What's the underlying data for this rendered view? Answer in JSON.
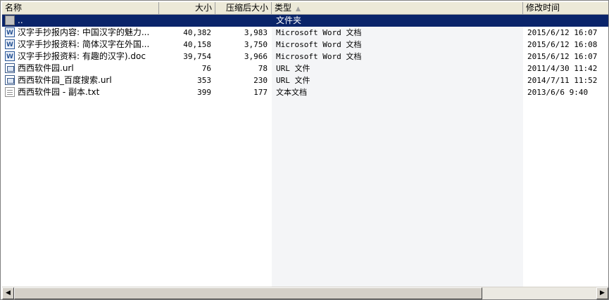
{
  "columns": {
    "name": "名称",
    "size": "大小",
    "compressed": "压缩后大小",
    "type": "类型",
    "modified": "修改时间"
  },
  "icons": {
    "sort_indicator": "sort-ascending-icon",
    "scroll_left": "◀",
    "scroll_right": "▶"
  },
  "colors": {
    "selection": "#0a246a",
    "sorted_column_bg": "#f4f5f7"
  },
  "rows": [
    {
      "icon": "parent-folder-icon",
      "name": "..",
      "size": "",
      "compressed": "",
      "type": "文件夹",
      "modified": "",
      "selected": true
    },
    {
      "icon": "word-document-icon",
      "name": "汉字手抄报内容: 中国汉字的魅力...",
      "size": "40,382",
      "compressed": "3,983",
      "type": "Microsoft Word 文档",
      "modified": "2015/6/12 16:07"
    },
    {
      "icon": "word-document-icon",
      "name": "汉字手抄报资料: 简体汉字在外国...",
      "size": "40,158",
      "compressed": "3,750",
      "type": "Microsoft Word 文档",
      "modified": "2015/6/12 16:08"
    },
    {
      "icon": "word-document-icon",
      "name": "汉字手抄报资料: 有趣的汉字).doc",
      "size": "39,754",
      "compressed": "3,966",
      "type": "Microsoft Word 文档",
      "modified": "2015/6/12 16:07"
    },
    {
      "icon": "url-shortcut-icon",
      "name": "西西软件园.url",
      "size": "76",
      "compressed": "78",
      "type": "URL 文件",
      "modified": "2011/4/30 11:42"
    },
    {
      "icon": "url-shortcut-icon",
      "name": "西西软件园_百度搜索.url",
      "size": "353",
      "compressed": "230",
      "type": "URL 文件",
      "modified": "2014/7/11 11:52"
    },
    {
      "icon": "text-document-icon",
      "name": "西西软件园 - 副本.txt",
      "size": "399",
      "compressed": "177",
      "type": "文本文档",
      "modified": "2013/6/6 9:40"
    }
  ]
}
